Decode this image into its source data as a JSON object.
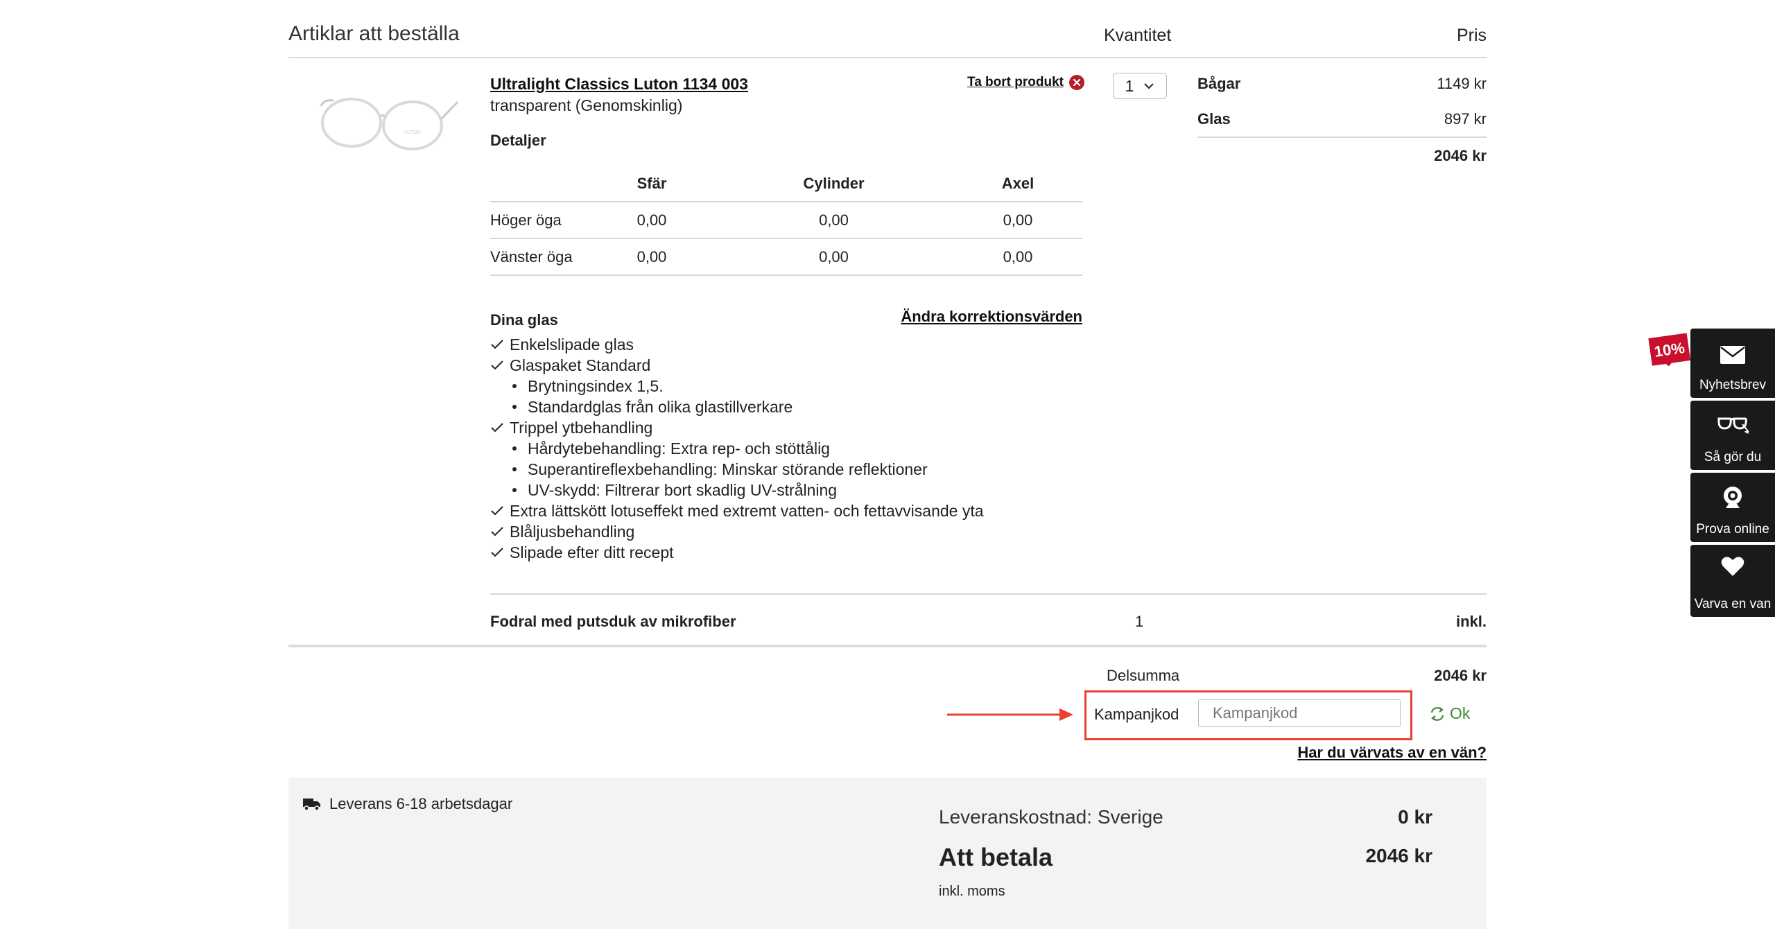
{
  "header": {
    "title": "Artiklar att beställa",
    "qty_col": "Kvantitet",
    "price_col": "Pris"
  },
  "product": {
    "name": "Ultralight Classics Luton 1134 003",
    "color": "transparent (Genomskinlig)",
    "remove_label": "Ta bort produkt",
    "quantity": "1",
    "details_heading": "Detaljer",
    "rx_table": {
      "columns": [
        "Sfär",
        "Cylinder",
        "Axel"
      ],
      "rows": [
        {
          "label": "Höger öga",
          "sph": "0,00",
          "cyl": "0,00",
          "axis": "0,00"
        },
        {
          "label": "Vänster öga",
          "sph": "0,00",
          "cyl": "0,00",
          "axis": "0,00"
        }
      ]
    },
    "lenses_heading": "Dina glas",
    "edit_rx_link": "Ändra korrektionsvärden",
    "features": [
      {
        "type": "check",
        "text": "Enkelslipade glas"
      },
      {
        "type": "check",
        "text": "Glaspaket Standard"
      },
      {
        "type": "bullet",
        "text": "Brytningsindex 1,5."
      },
      {
        "type": "bullet",
        "text": "Standardglas från olika glastillverkare"
      },
      {
        "type": "check",
        "text": "Trippel ytbehandling"
      },
      {
        "type": "bullet",
        "text": "Hårdytebehandling: Extra rep- och stöttålig"
      },
      {
        "type": "bullet",
        "text": "Superantireflexbehandling: Minskar störande reflektioner"
      },
      {
        "type": "bullet",
        "text": "UV-skydd: Filtrerar bort skadlig UV-strålning"
      },
      {
        "type": "check",
        "text": "Extra lättskött lotuseffekt med extremt vatten- och fettavvisande yta"
      },
      {
        "type": "check",
        "text": "Blåljusbehandling"
      },
      {
        "type": "check",
        "text": "Slipade efter ditt recept"
      }
    ]
  },
  "pricing": {
    "frame_label": "Bågar",
    "frame_price": "1149 kr",
    "lens_label": "Glas",
    "lens_price": "897 kr",
    "item_total": "2046 kr"
  },
  "accessory": {
    "name": "Fodral med putsduk av mikrofiber",
    "qty": "1",
    "price": "inkl."
  },
  "summary": {
    "subtotal_label": "Delsumma",
    "subtotal": "2046 kr",
    "promo_label": "Kampanjkod",
    "promo_placeholder": "Kampanjkod",
    "promo_button": "Ok",
    "referral_link": "Har du värvats av en vän?"
  },
  "delivery": {
    "time": "Leverans 6-18 arbetsdagar",
    "cost_label": "Leveranskostnad: Sverige",
    "cost": "0 kr",
    "pay_label": "Att betala",
    "pay_amount": "2046 kr",
    "vat_note": "inkl. moms"
  },
  "sidebar": {
    "badge": "10%",
    "items": [
      {
        "label": "Nyhetsbrev",
        "icon": "envelope-icon"
      },
      {
        "label": "Så gör du",
        "icon": "glasses-icon"
      },
      {
        "label": "Prova online",
        "icon": "webcam-icon"
      },
      {
        "label": "Varva en van",
        "icon": "heart-icon"
      }
    ]
  },
  "colors": {
    "accent_red": "#e8402c",
    "ok_green": "#3b8a2e",
    "remove_red": "#b71c2a",
    "badge_red": "#c8102e",
    "sidebar_bg": "#1a1a1a"
  }
}
